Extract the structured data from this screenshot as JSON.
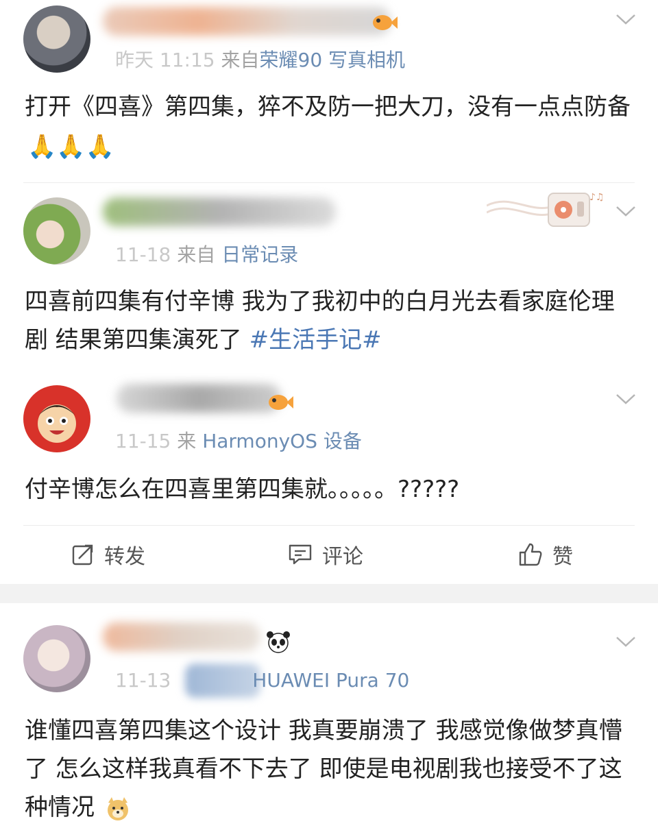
{
  "posts": [
    {
      "meta_time": "昨天 11:15",
      "meta_from": "来自",
      "meta_device": "荣耀90 写真相机",
      "text": "打开《四喜》第四集，猝不及防一把大刀，没有一点点防备",
      "emoji": "🙏🙏🙏"
    },
    {
      "meta_time": "11-18",
      "meta_from": "来自",
      "meta_device": "日常记录",
      "text": "四喜前四集有付辛博 我为了我初中的白月光去看家庭伦理剧 结果第四集演死了 ",
      "hashtag": "#生活手记#"
    },
    {
      "meta_time": "11-15",
      "meta_from": "来",
      "meta_device": "HarmonyOS 设备",
      "text": "付辛博怎么在四喜里第四集就。。。。。?????"
    },
    {
      "meta_time": "11-13",
      "meta_device": "HUAWEI Pura 70",
      "text": "谁懂四喜第四集这个设计 我真要崩溃了 我感觉像做梦真懵了 怎么这样我真看不下去了 即使是电视剧我也接受不了这种情况"
    }
  ],
  "actions": {
    "repost_label": "转发",
    "comment_label": "评论",
    "like_label": "赞"
  },
  "colors": {
    "link": "#4a77b4",
    "meta": "#a3a3a3",
    "separator": "#f2f2f2"
  }
}
